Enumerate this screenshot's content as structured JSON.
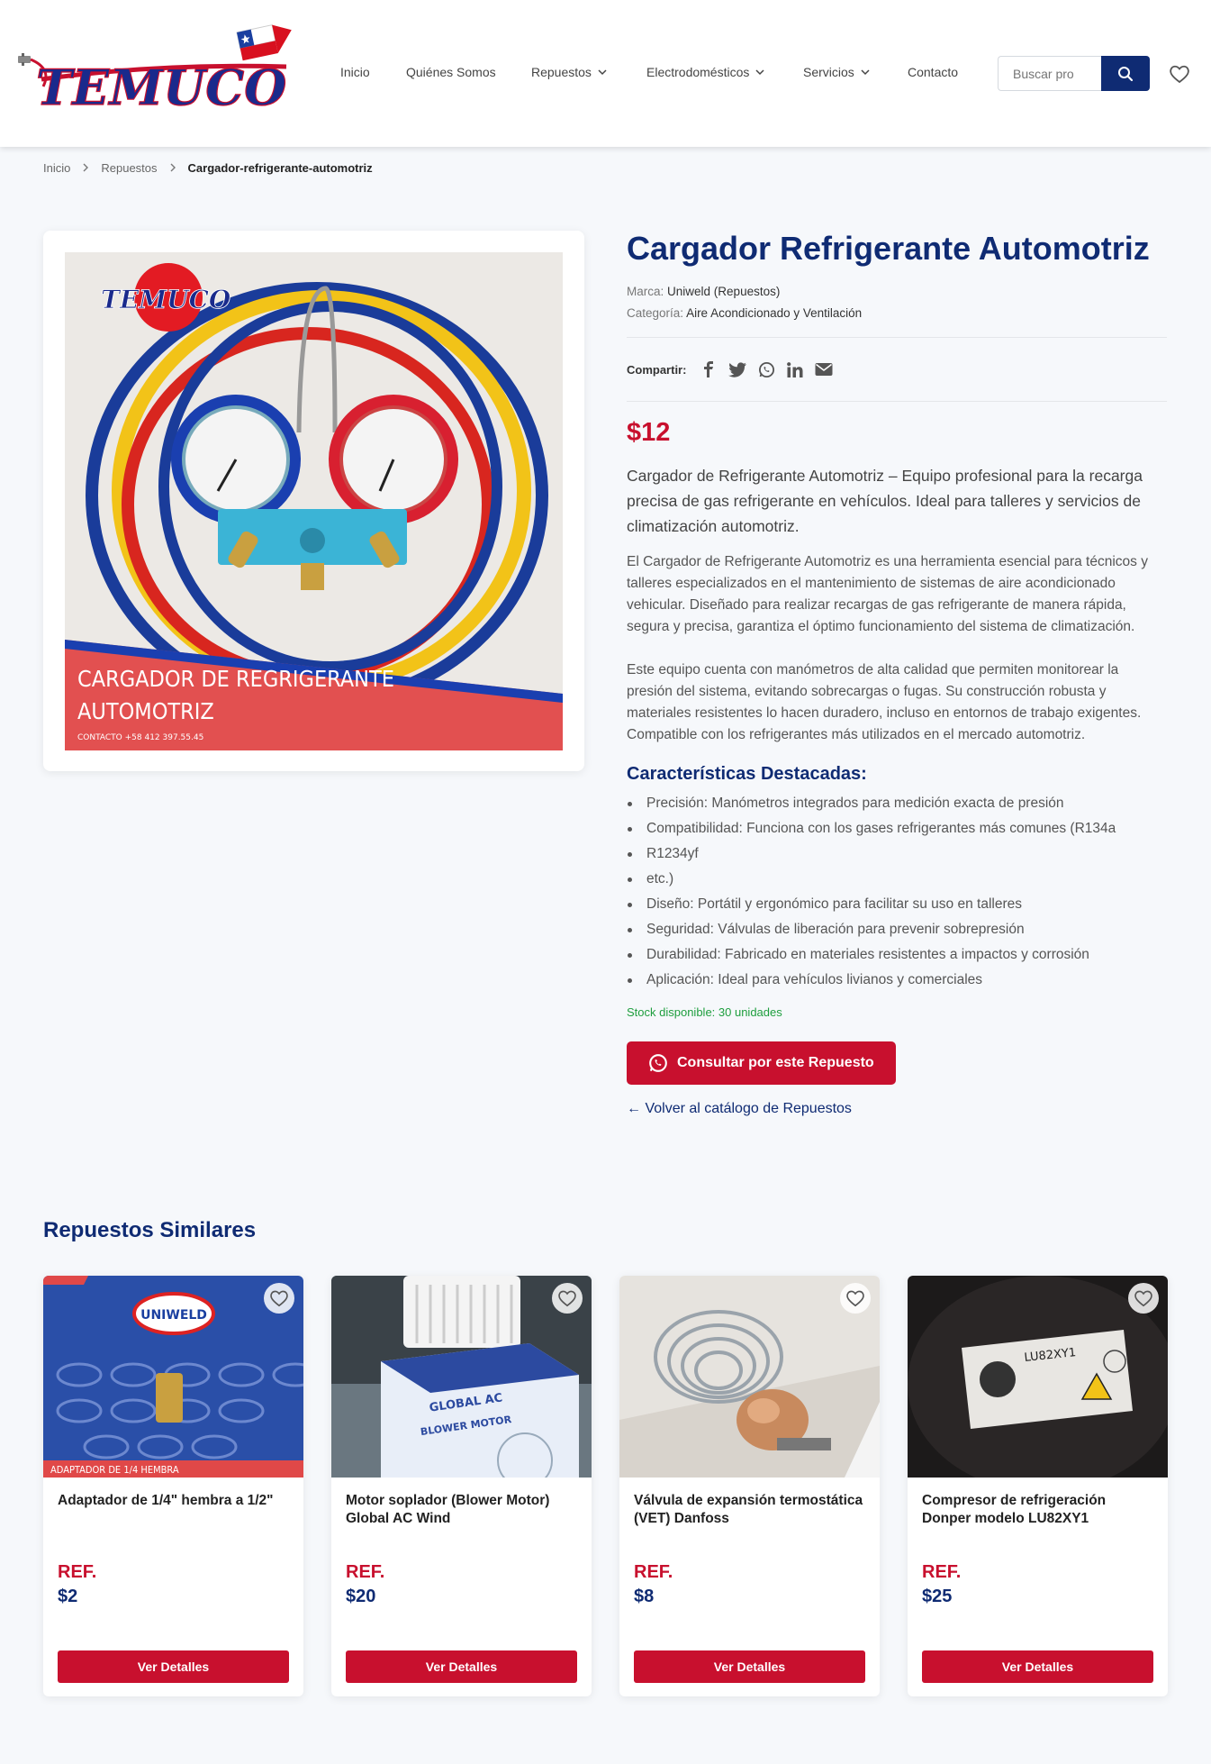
{
  "header": {
    "logo_text": "TEMUCO",
    "nav": [
      {
        "label": "Inicio",
        "dropdown": false
      },
      {
        "label": "Quiénes Somos",
        "dropdown": false
      },
      {
        "label": "Repuestos",
        "dropdown": true
      },
      {
        "label": "Electrodomésticos",
        "dropdown": true
      },
      {
        "label": "Servicios",
        "dropdown": true
      },
      {
        "label": "Contacto",
        "dropdown": false
      }
    ],
    "search_placeholder": "Buscar pro"
  },
  "breadcrumb": [
    "Inicio",
    "Repuestos",
    "Cargador-refrigerante-automotriz"
  ],
  "product": {
    "title": "Cargador Refrigerante Automotriz",
    "brand_label": "Marca:",
    "brand": "Uniweld (Repuestos)",
    "category_label": "Categoría:",
    "category": "Aire Acondicionado y Ventilación",
    "share_label": "Compartir:",
    "price": "$12",
    "lead": "Cargador de Refrigerante Automotriz – Equipo profesional para la recarga precisa de gas refrigerante en vehículos. Ideal para talleres y servicios de climatización automotriz.",
    "para1": "El Cargador de Refrigerante Automotriz es una herramienta esencial para técnicos y talleres especializados en el mantenimiento de sistemas de aire acondicionado vehicular. Diseñado para realizar recargas de gas refrigerante de manera rápida, segura y precisa, garantiza el óptimo funcionamiento del sistema de climatización.",
    "para2": "Este equipo cuenta con manómetros de alta calidad que permiten monitorear la presión del sistema, evitando sobrecargas o fugas. Su construcción robusta y materiales resistentes lo hacen duradero, incluso en entornos de trabajo exigentes. Compatible con los refrigerantes más utilizados en el mercado automotriz.",
    "features_title": "Características Destacadas:",
    "features": [
      "Precisión: Manómetros integrados para medición exacta de presión",
      "Compatibilidad: Funciona con los gases refrigerantes más comunes (R134a",
      "R1234yf",
      "etc.)",
      "Diseño: Portátil y ergonómico para facilitar su uso en talleres",
      "Seguridad: Válvulas de liberación para prevenir sobrepresión",
      "Durabilidad: Fabricado en materiales resistentes a impactos y corrosión",
      "Aplicación: Ideal para vehículos livianos y comerciales"
    ],
    "stock": "Stock disponible: 30 unidades",
    "cta": "Consultar por este Repuesto",
    "back": "← Volver al catálogo de Repuestos",
    "image_caption_line1": "CARGADOR DE REGRIGERANTE",
    "image_caption_line2": "AUTOMOTRIZ",
    "image_contact": "CONTACTO +58 412 397.55.45"
  },
  "similar": {
    "title": "Repuestos Similares",
    "items": [
      {
        "name": "Adaptador de 1/4\" hembra a 1/2\"",
        "ref": "REF.",
        "price": "$2",
        "button": "Ver Detalles",
        "image_label": "ADAPTADOR DE 1/4 HEMBRA",
        "image_brand": "UNIWELD"
      },
      {
        "name": "Motor soplador (Blower Motor) Global AC Wind",
        "ref": "REF.",
        "price": "$20",
        "button": "Ver Detalles",
        "image_brand": "GLOBAL AC",
        "image_label": "BLOWER MOTOR"
      },
      {
        "name": "Válvula de expansión termostática (VET) Danfoss",
        "ref": "REF.",
        "price": "$8",
        "button": "Ver Detalles"
      },
      {
        "name": "Compresor de refrigeración Donper modelo LU82XY1",
        "ref": "REF.",
        "price": "$25",
        "button": "Ver Detalles",
        "image_label": "LU82XY1"
      }
    ]
  },
  "colors": {
    "primary_navy": "#0f2b73",
    "accent_red": "#c8102e",
    "stock_green": "#1e9e3e",
    "background": "#f6f8fb"
  },
  "icons": [
    "search-icon",
    "heart-icon",
    "chevron-right-icon",
    "chevron-down-icon",
    "facebook-icon",
    "twitter-icon",
    "whatsapp-icon",
    "linkedin-icon",
    "email-icon"
  ]
}
